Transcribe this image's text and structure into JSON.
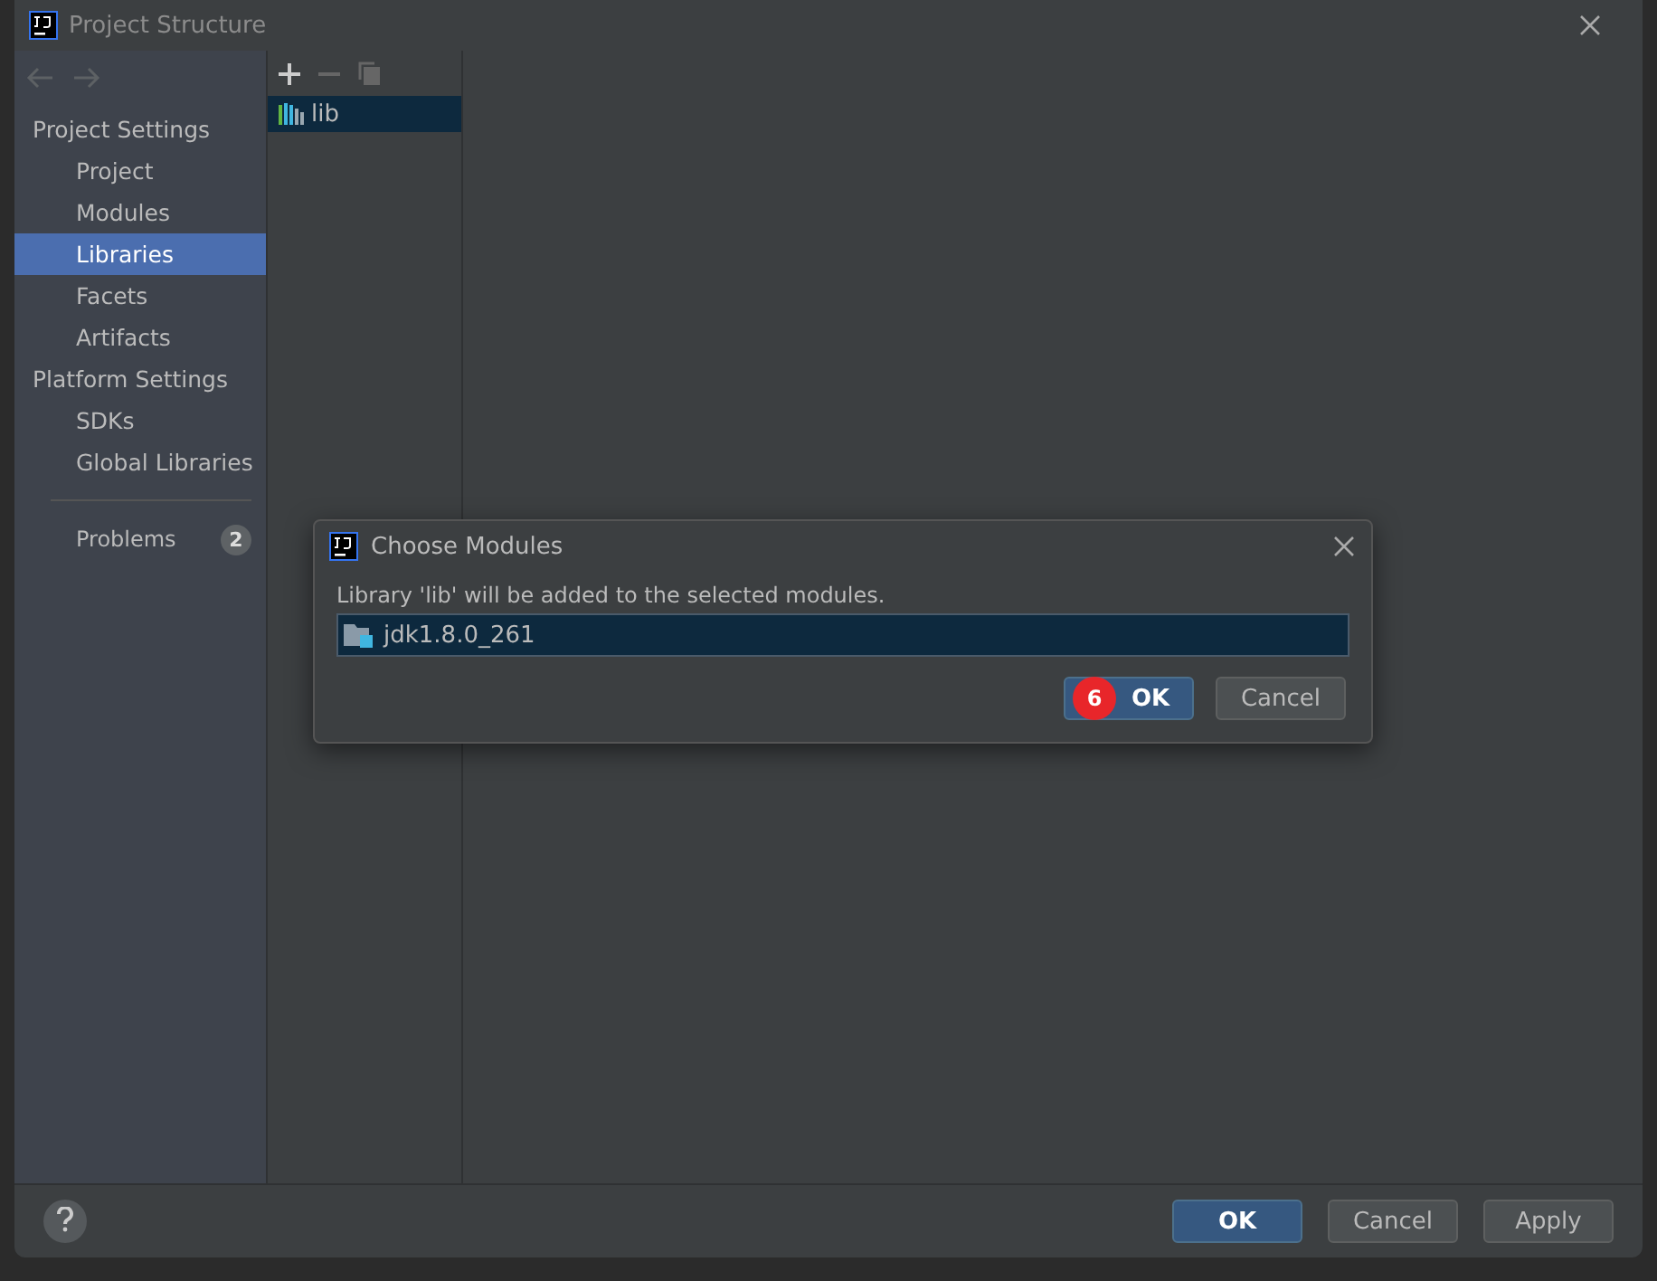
{
  "window": {
    "title": "Project Structure"
  },
  "sidebar": {
    "groups": [
      {
        "title": "Project Settings",
        "items": [
          {
            "label": "Project",
            "selected": false
          },
          {
            "label": "Modules",
            "selected": false
          },
          {
            "label": "Libraries",
            "selected": true
          },
          {
            "label": "Facets",
            "selected": false
          },
          {
            "label": "Artifacts",
            "selected": false
          }
        ]
      },
      {
        "title": "Platform Settings",
        "items": [
          {
            "label": "SDKs",
            "selected": false
          },
          {
            "label": "Global Libraries",
            "selected": false
          }
        ]
      }
    ],
    "problems": {
      "label": "Problems",
      "count": "2"
    }
  },
  "libraries": [
    {
      "name": "lib",
      "selected": true
    }
  ],
  "dialog": {
    "title": "Choose Modules",
    "message": "Library 'lib' will be added to the selected modules.",
    "modules": [
      {
        "name": "jdk1.8.0_261",
        "selected": true
      }
    ],
    "buttons": [
      {
        "label": "OK",
        "kind": "primary"
      },
      {
        "label": "Cancel",
        "kind": "normal"
      }
    ],
    "step_badge": "6"
  },
  "buttons": [
    {
      "label": "OK",
      "kind": "primary"
    },
    {
      "label": "Cancel",
      "kind": "normal"
    },
    {
      "label": "Apply",
      "kind": "normal"
    }
  ]
}
